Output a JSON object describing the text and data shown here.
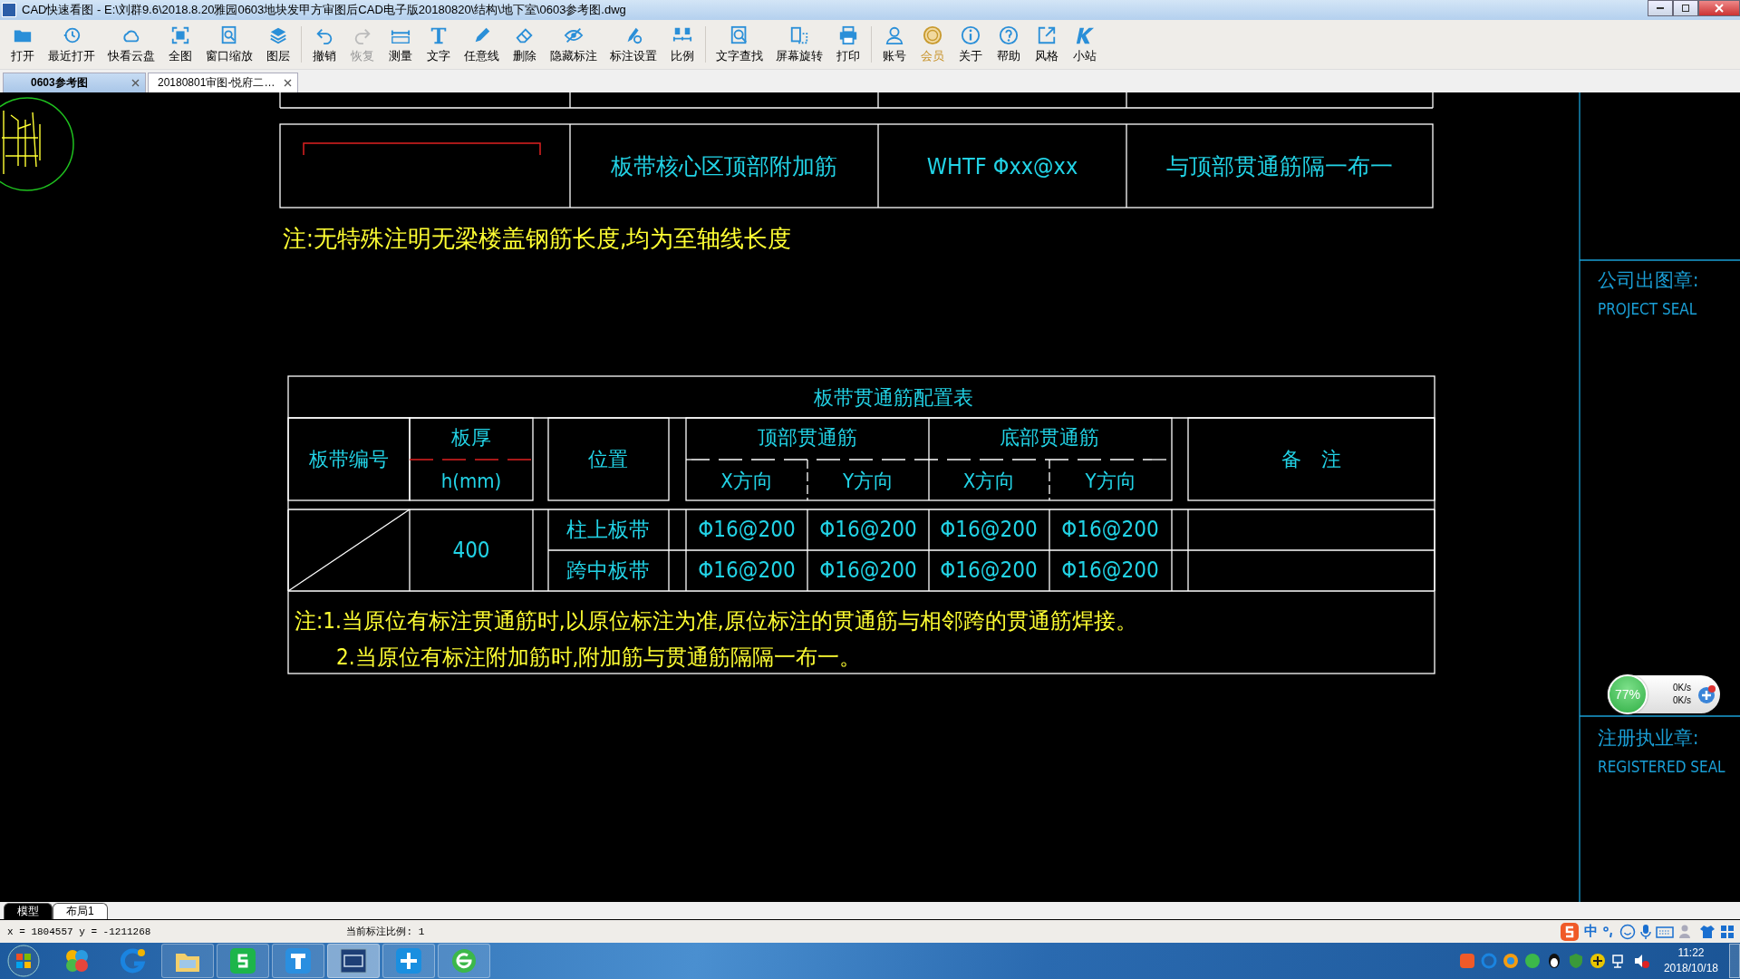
{
  "window": {
    "title": "CAD快速看图 - E:\\刘群9.6\\2018.8.20雅园0603地块发甲方审图后CAD电子版20180820\\结构\\地下室\\0603参考图.dwg"
  },
  "toolbar": {
    "groups": [
      [
        {
          "label": "打开",
          "disabled": false,
          "highlight": false
        },
        {
          "label": "最近打开",
          "disabled": false,
          "highlight": false
        },
        {
          "label": "快看云盘",
          "disabled": false,
          "highlight": false
        },
        {
          "label": "全图",
          "disabled": false,
          "highlight": false
        },
        {
          "label": "窗口缩放",
          "disabled": false,
          "highlight": false
        },
        {
          "label": "图层",
          "disabled": false,
          "highlight": false
        }
      ],
      [
        {
          "label": "撤销",
          "disabled": false,
          "highlight": false
        },
        {
          "label": "恢复",
          "disabled": true,
          "highlight": false
        },
        {
          "label": "测量",
          "disabled": false,
          "highlight": false
        },
        {
          "label": "文字",
          "disabled": false,
          "highlight": false
        },
        {
          "label": "任意线",
          "disabled": false,
          "highlight": false
        },
        {
          "label": "删除",
          "disabled": false,
          "highlight": false
        },
        {
          "label": "隐藏标注",
          "disabled": false,
          "highlight": false
        },
        {
          "label": "标注设置",
          "disabled": false,
          "highlight": false
        },
        {
          "label": "比例",
          "disabled": false,
          "highlight": false
        }
      ],
      [
        {
          "label": "文字查找",
          "disabled": false,
          "highlight": false
        },
        {
          "label": "屏幕旋转",
          "disabled": false,
          "highlight": false
        },
        {
          "label": "打印",
          "disabled": false,
          "highlight": false
        }
      ],
      [
        {
          "label": "账号",
          "disabled": false,
          "highlight": false
        },
        {
          "label": "会员",
          "disabled": false,
          "highlight": true
        },
        {
          "label": "关于",
          "disabled": false,
          "highlight": false
        },
        {
          "label": "帮助",
          "disabled": false,
          "highlight": false
        },
        {
          "label": "风格",
          "disabled": false,
          "highlight": false
        },
        {
          "label": "小站",
          "disabled": false,
          "highlight": false
        }
      ]
    ]
  },
  "tabs": [
    {
      "label": "0603参考图",
      "selected": true
    },
    {
      "label": "20180801审图-悦府二…",
      "selected": false
    }
  ],
  "drawing": {
    "upper_table": {
      "cells": [
        "板带核心区顶部附加筋",
        "WHTF Φxx@xx",
        "与顶部贯通筋隔一布一"
      ]
    },
    "note": "注:无特殊注明无梁楼盖钢筋长度,均为至轴线长度",
    "rebar_table": {
      "title": "板带贯通筋配置表",
      "id_header": "板带编号",
      "thickness_header": "板厚",
      "thickness_unit": "h(mm)",
      "position_header": "位置",
      "bar_groups": [
        {
          "title": "顶部贯通筋",
          "sub": [
            "X方向",
            "Y方向"
          ]
        },
        {
          "title": "底部贯通筋",
          "sub": [
            "X方向",
            "Y方向"
          ]
        }
      ],
      "remark_header": "备　注",
      "thickness": "400",
      "rows": [
        {
          "position": "柱上板带",
          "bars": [
            "Φ16@200",
            "Φ16@200",
            "Φ16@200",
            "Φ16@200"
          ]
        },
        {
          "position": "跨中板带",
          "bars": [
            "Φ16@200",
            "Φ16@200",
            "Φ16@200",
            "Φ16@200"
          ]
        }
      ],
      "notes": [
        "注:1.当原位有标注贯通筋时,以原位标注为准,原位标注的贯通筋与相邻跨的贯通筋焊接。",
        "2.当原位有标注附加筋时,附加筋与贯通筋隔隔一布一。"
      ]
    },
    "seals": [
      {
        "label": "公司出图章:",
        "sublabel": "PROJECT SEAL"
      },
      {
        "label": "注册执业章:",
        "sublabel": "REGISTERED SEAL"
      }
    ]
  },
  "net_widget": {
    "percent": "77%",
    "up": "0K/s",
    "down": "0K/s"
  },
  "layout_tabs": [
    {
      "label": "模型",
      "selected": true
    },
    {
      "label": "布局1",
      "selected": false
    }
  ],
  "status_bar": {
    "coordinates": "x = 1804557 y = -1211268",
    "scale": "当前标注比例: 1"
  },
  "ime": {
    "mode": "中"
  },
  "taskbar": {
    "time": "11:22",
    "date": "2018/10/18"
  }
}
